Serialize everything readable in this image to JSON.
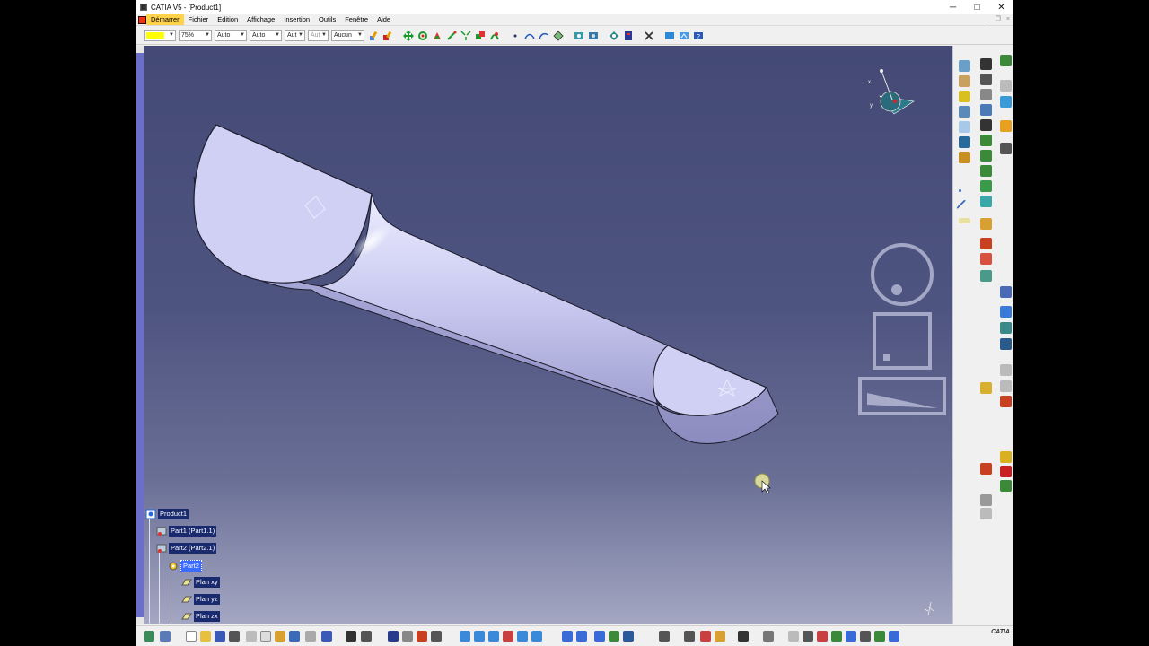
{
  "window": {
    "title": "CATIA V5 - [Product1]",
    "minimize": "─",
    "maximize": "□",
    "close": "✕",
    "mdi_minimize": "_",
    "mdi_restore": "❐",
    "mdi_close": "×"
  },
  "menu": {
    "items": [
      {
        "label": "Démarrer",
        "active": true
      },
      {
        "label": "Fichier"
      },
      {
        "label": "Edition"
      },
      {
        "label": "Affichage"
      },
      {
        "label": "Insertion"
      },
      {
        "label": "Outils"
      },
      {
        "label": "Fenêtre"
      },
      {
        "label": "Aide"
      }
    ]
  },
  "toolbar": {
    "color_value": "#ffff00",
    "transparency": "75%",
    "linetype": "Auto",
    "thickness": "Auto",
    "point": "Aut",
    "layer_disabled": "Aut",
    "layer": "Aucun",
    "icons": [
      "paint-brush-icon",
      "painter-icon",
      "move-icon",
      "rotate-icon",
      "snap-icon",
      "manipulate-icon",
      "explode-icon",
      "clash-icon",
      "sectioning-icon",
      "point-icon",
      "arc-icon",
      "curve-icon",
      "fill-icon",
      "constraint-icon",
      "analysis-icon",
      "view-icon",
      "measure-icon",
      "tools-icon",
      "catalog-icon",
      "graph-icon",
      "help-icon"
    ]
  },
  "viewport": {
    "background_top": "#444a75",
    "background_bottom": "#a4a7c2",
    "part_color": "#c8c8f0"
  },
  "tree": {
    "nodes": [
      {
        "label": "Product1"
      },
      {
        "label": "Part1 (Part1.1)"
      },
      {
        "label": "Part2 (Part2.1)"
      },
      {
        "label": "Part2",
        "selected": true
      },
      {
        "label": "Plan xy"
      },
      {
        "label": "Plan yz"
      },
      {
        "label": "Plan zx"
      }
    ]
  },
  "compass": {
    "x_label": "x",
    "y_label": "y"
  },
  "brand": {
    "logo_text": "CATIA"
  }
}
